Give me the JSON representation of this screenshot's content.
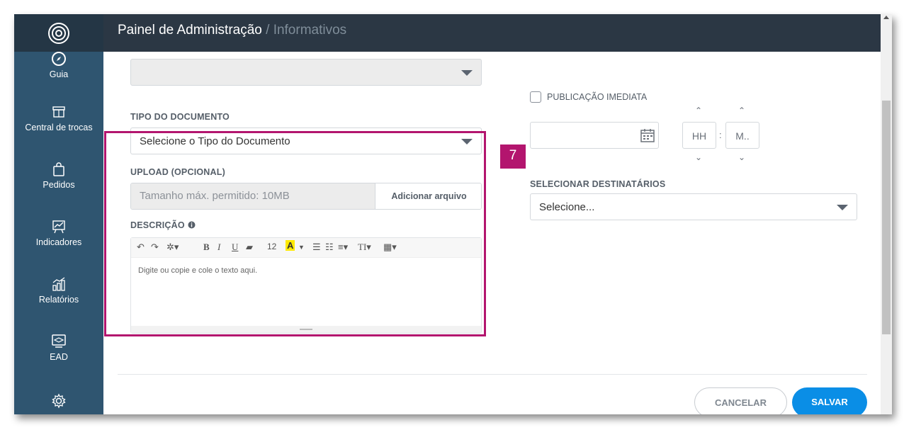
{
  "header": {
    "title": "Painel de Administração",
    "separator": " / ",
    "crumb": "Informativos"
  },
  "sidebar": {
    "items": [
      {
        "label": "Guia",
        "icon": "compass-icon"
      },
      {
        "label": "Central de trocas",
        "icon": "store-icon"
      },
      {
        "label": "Pedidos",
        "icon": "shopping-bag-icon"
      },
      {
        "label": "Indicadores",
        "icon": "presentation-chart-icon"
      },
      {
        "label": "Relatórios",
        "icon": "bar-chart-icon"
      },
      {
        "label": "EAD",
        "icon": "graduation-monitor-icon"
      },
      {
        "label": "",
        "icon": "gear-icon"
      }
    ]
  },
  "form": {
    "tipo_label": "TIPO DO DOCUMENTO",
    "tipo_value": "Selecione o Tipo do Documento",
    "upload_label": "UPLOAD (OPCIONAL)",
    "upload_placeholder": "Tamanho máx. permitido: 10MB",
    "upload_button": "Adicionar arquivo",
    "descricao_label": "DESCRIÇÃO",
    "editor_font_size": "12",
    "editor_placeholder": "Digite ou copie e cole o texto aqui.",
    "publicacao_label": "PUBLICAÇÃO IMEDIATA",
    "hour_placeholder": "HH",
    "time_separator": ":",
    "minute_placeholder": "M..",
    "destinatarios_label": "SELECIONAR DESTINATÁRIOS",
    "destinatarios_value": "Selecione..."
  },
  "annotation": {
    "step": "7",
    "color": "#b3156e"
  },
  "actions": {
    "cancel": "CANCELAR",
    "save": "SALVAR"
  },
  "colors": {
    "sidebar": "#2f5570",
    "header": "#2b3744",
    "primary": "#0a8ee6"
  }
}
